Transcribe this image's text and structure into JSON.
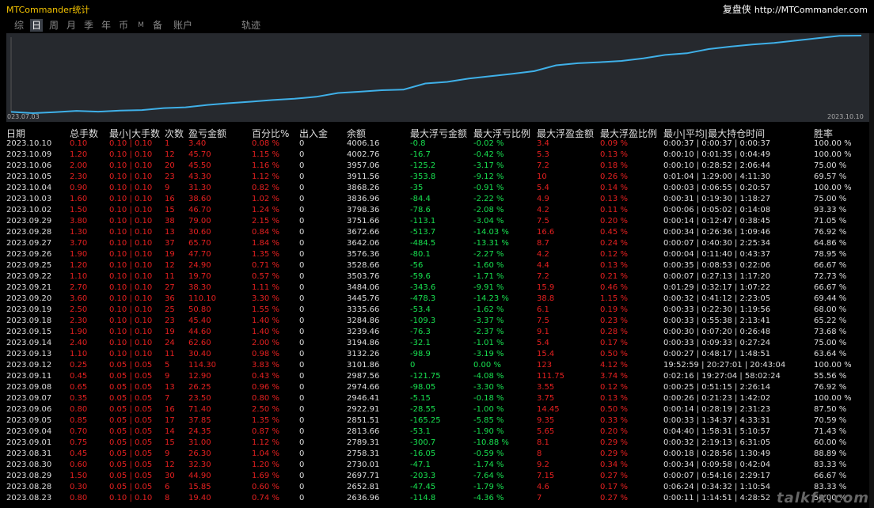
{
  "window": {
    "title": "MTCommander统计",
    "brand_cn": "复盘侠",
    "brand_url": "http://MTCommander.com"
  },
  "tabs": [
    {
      "label": "综",
      "active": false,
      "small": false
    },
    {
      "label": "日",
      "active": true,
      "small": false
    },
    {
      "label": "周",
      "active": false,
      "small": false
    },
    {
      "label": "月",
      "active": false,
      "small": false
    },
    {
      "label": "季",
      "active": false,
      "small": false
    },
    {
      "label": "年",
      "active": false,
      "small": false
    },
    {
      "label": "币",
      "active": false,
      "small": false
    },
    {
      "label": "M",
      "active": false,
      "small": true
    },
    {
      "label": "备",
      "active": false,
      "small": false
    },
    {
      "label": "账户",
      "active": false,
      "small": false
    },
    {
      "label": "轨迹",
      "active": false,
      "small": false
    }
  ],
  "chart_data": {
    "type": "line",
    "x_start_label": "023.07.03",
    "x_end_label": "2023.10.10",
    "line_color": "#3fb0e8",
    "values": [
      2565.51,
      2542.0,
      2560.0,
      2586.0,
      2571.0,
      2590.0,
      2600.0,
      2636.96,
      2652.81,
      2697.71,
      2730.01,
      2758.31,
      2789.31,
      2813.66,
      2851.51,
      2922.91,
      2946.41,
      2974.66,
      2987.56,
      3101.86,
      3132.26,
      3194.86,
      3239.46,
      3284.86,
      3335.66,
      3445.76,
      3484.06,
      3503.76,
      3528.66,
      3576.36,
      3642.06,
      3672.66,
      3751.66,
      3798.36,
      3836.96,
      3868.26,
      3911.56,
      3957.06,
      4002.76,
      4006.16
    ]
  },
  "table": {
    "headers": [
      "日期",
      "总手数",
      "最小|大手数",
      "次数",
      "盈亏金额",
      "百分比%",
      "出入金",
      "余额",
      "最大浮亏金额",
      "最大浮亏比例",
      "最大浮盈金额",
      "最大浮盈比例",
      "最小|平均|最大持仓时间",
      "胜率"
    ],
    "rows": [
      [
        "2023.10.10",
        "0.10",
        "0.10 | 0.10",
        "1",
        "3.40",
        "0.08 %",
        "0",
        "4006.16",
        "-0.8",
        "-0.02 %",
        "3.4",
        "0.09 %",
        "0:00:37 | 0:00:37 | 0:00:37",
        "100.00 %"
      ],
      [
        "2023.10.09",
        "1.20",
        "0.10 | 0.10",
        "12",
        "45.70",
        "1.15 %",
        "0",
        "4002.76",
        "-16.7",
        "-0.42 %",
        "5.3",
        "0.13 %",
        "0:00:10 | 0:01:35 | 0:04:49",
        "100.00 %"
      ],
      [
        "2023.10.06",
        "2.00",
        "0.10 | 0.10",
        "20",
        "45.50",
        "1.16 %",
        "0",
        "3957.06",
        "-125.2",
        "-3.17 %",
        "7.2",
        "0.18 %",
        "0:00:10 | 0:28:52 | 2:06:44",
        "75.00 %"
      ],
      [
        "2023.10.05",
        "2.30",
        "0.10 | 0.10",
        "23",
        "43.30",
        "1.12 %",
        "0",
        "3911.56",
        "-353.8",
        "-9.12 %",
        "10",
        "0.26 %",
        "0:01:04 | 1:29:00 | 4:11:30",
        "69.57 %"
      ],
      [
        "2023.10.04",
        "0.90",
        "0.10 | 0.10",
        "9",
        "31.30",
        "0.82 %",
        "0",
        "3868.26",
        "-35",
        "-0.91 %",
        "5.4",
        "0.14 %",
        "0:00:03 | 0:06:55 | 0:20:57",
        "100.00 %"
      ],
      [
        "2023.10.03",
        "1.60",
        "0.10 | 0.10",
        "16",
        "38.60",
        "1.02 %",
        "0",
        "3836.96",
        "-84.4",
        "-2.22 %",
        "4.9",
        "0.13 %",
        "0:00:31 | 0:19:30 | 1:18:27",
        "75.00 %"
      ],
      [
        "2023.10.02",
        "1.50",
        "0.10 | 0.10",
        "15",
        "46.70",
        "1.24 %",
        "0",
        "3798.36",
        "-78.6",
        "-2.08 %",
        "4.2",
        "0.11 %",
        "0:00:06 | 0:05:02 | 0:14:08",
        "93.33 %"
      ],
      [
        "2023.09.29",
        "3.80",
        "0.10 | 0.10",
        "38",
        "79.00",
        "2.15 %",
        "0",
        "3751.66",
        "-113.1",
        "-3.04 %",
        "7.5",
        "0.20 %",
        "0:00:14 | 0:12:47 | 0:38:45",
        "71.05 %"
      ],
      [
        "2023.09.28",
        "1.30",
        "0.10 | 0.10",
        "13",
        "30.60",
        "0.84 %",
        "0",
        "3672.66",
        "-513.7",
        "-14.03 %",
        "16.6",
        "0.45 %",
        "0:00:34 | 0:26:36 | 1:09:46",
        "76.92 %"
      ],
      [
        "2023.09.27",
        "3.70",
        "0.10 | 0.10",
        "37",
        "65.70",
        "1.84 %",
        "0",
        "3642.06",
        "-484.5",
        "-13.31 %",
        "8.7",
        "0.24 %",
        "0:00:07 | 0:40:30 | 2:25:34",
        "64.86 %"
      ],
      [
        "2023.09.26",
        "1.90",
        "0.10 | 0.10",
        "19",
        "47.70",
        "1.35 %",
        "0",
        "3576.36",
        "-80.1",
        "-2.27 %",
        "4.2",
        "0.12 %",
        "0:00:04 | 0:11:40 | 0:43:37",
        "78.95 %"
      ],
      [
        "2023.09.25",
        "1.20",
        "0.10 | 0.10",
        "12",
        "24.90",
        "0.71 %",
        "0",
        "3528.66",
        "-56",
        "-1.60 %",
        "4.4",
        "0.13 %",
        "0:00:35 | 0:08:53 | 0:22:06",
        "66.67 %"
      ],
      [
        "2023.09.22",
        "1.10",
        "0.10 | 0.10",
        "11",
        "19.70",
        "0.57 %",
        "0",
        "3503.76",
        "-59.6",
        "-1.71 %",
        "7.2",
        "0.21 %",
        "0:00:07 | 0:27:13 | 1:17:20",
        "72.73 %"
      ],
      [
        "2023.09.21",
        "2.70",
        "0.10 | 0.10",
        "27",
        "38.30",
        "1.11 %",
        "0",
        "3484.06",
        "-343.6",
        "-9.91 %",
        "15.9",
        "0.46 %",
        "0:01:29 | 0:32:17 | 1:07:22",
        "66.67 %"
      ],
      [
        "2023.09.20",
        "3.60",
        "0.10 | 0.10",
        "36",
        "110.10",
        "3.30 %",
        "0",
        "3445.76",
        "-478.3",
        "-14.23 %",
        "38.8",
        "1.15 %",
        "0:00:32 | 0:41:12 | 2:23:05",
        "69.44 %"
      ],
      [
        "2023.09.19",
        "2.50",
        "0.10 | 0.10",
        "25",
        "50.80",
        "1.55 %",
        "0",
        "3335.66",
        "-53.4",
        "-1.62 %",
        "6.1",
        "0.19 %",
        "0:00:33 | 0:22:30 | 1:19:56",
        "68.00 %"
      ],
      [
        "2023.09.18",
        "2.30",
        "0.10 | 0.10",
        "23",
        "45.40",
        "1.40 %",
        "0",
        "3284.86",
        "-109.3",
        "-3.37 %",
        "7.5",
        "0.23 %",
        "0:00:33 | 0:55:38 | 2:13:41",
        "65.22 %"
      ],
      [
        "2023.09.15",
        "1.90",
        "0.10 | 0.10",
        "19",
        "44.60",
        "1.40 %",
        "0",
        "3239.46",
        "-76.3",
        "-2.37 %",
        "9.1",
        "0.28 %",
        "0:00:30 | 0:07:20 | 0:26:48",
        "73.68 %"
      ],
      [
        "2023.09.14",
        "2.40",
        "0.10 | 0.10",
        "24",
        "62.60",
        "2.00 %",
        "0",
        "3194.86",
        "-32.1",
        "-1.01 %",
        "5.4",
        "0.17 %",
        "0:00:33 | 0:09:33 | 0:27:24",
        "75.00 %"
      ],
      [
        "2023.09.13",
        "1.10",
        "0.10 | 0.10",
        "11",
        "30.40",
        "0.98 %",
        "0",
        "3132.26",
        "-98.9",
        "-3.19 %",
        "15.4",
        "0.50 %",
        "0:00:27 | 0:48:17 | 1:48:51",
        "63.64 %"
      ],
      [
        "2023.09.12",
        "0.25",
        "0.05 | 0.05",
        "5",
        "114.30",
        "3.83 %",
        "0",
        "3101.86",
        "0",
        "0.00 %",
        "123",
        "4.12 %",
        "19:52:59 | 20:27:01 | 20:43:04",
        "100.00 %"
      ],
      [
        "2023.09.11",
        "0.45",
        "0.05 | 0.05",
        "9",
        "12.90",
        "0.43 %",
        "0",
        "2987.56",
        "-121.75",
        "-4.08 %",
        "111.75",
        "3.74 %",
        "0:02:16 | 19:27:04 | 58:02:24",
        "55.56 %"
      ],
      [
        "2023.09.08",
        "0.65",
        "0.05 | 0.05",
        "13",
        "26.25",
        "0.96 %",
        "0",
        "2974.66",
        "-98.05",
        "-3.30 %",
        "3.55",
        "0.12 %",
        "0:00:25 | 0:51:15 | 2:26:14",
        "76.92 %"
      ],
      [
        "2023.09.07",
        "0.35",
        "0.05 | 0.05",
        "7",
        "23.50",
        "0.80 %",
        "0",
        "2946.41",
        "-5.15",
        "-0.18 %",
        "3.75",
        "0.13 %",
        "0:00:26 | 0:21:23 | 1:42:02",
        "100.00 %"
      ],
      [
        "2023.09.06",
        "0.80",
        "0.05 | 0.05",
        "16",
        "71.40",
        "2.50 %",
        "0",
        "2922.91",
        "-28.55",
        "-1.00 %",
        "14.45",
        "0.50 %",
        "0:00:14 | 0:28:19 | 2:31:23",
        "87.50 %"
      ],
      [
        "2023.09.05",
        "0.85",
        "0.05 | 0.05",
        "17",
        "37.85",
        "1.35 %",
        "0",
        "2851.51",
        "-165.25",
        "-5.85 %",
        "9.35",
        "0.33 %",
        "0:00:33 | 1:34:37 | 4:33:31",
        "70.59 %"
      ],
      [
        "2023.09.04",
        "0.70",
        "0.05 | 0.05",
        "14",
        "24.35",
        "0.87 %",
        "0",
        "2813.66",
        "-53.1",
        "-1.90 %",
        "5.65",
        "0.20 %",
        "0:04:40 | 1:58:31 | 5:10:57",
        "71.43 %"
      ],
      [
        "2023.09.01",
        "0.75",
        "0.05 | 0.05",
        "15",
        "31.00",
        "1.12 %",
        "0",
        "2789.31",
        "-300.7",
        "-10.88 %",
        "8.1",
        "0.29 %",
        "0:00:32 | 2:19:13 | 6:31:05",
        "60.00 %"
      ],
      [
        "2023.08.31",
        "0.45",
        "0.05 | 0.05",
        "9",
        "26.30",
        "1.04 %",
        "0",
        "2758.31",
        "-16.05",
        "-0.59 %",
        "8",
        "0.29 %",
        "0:00:18 | 0:28:56 | 1:30:49",
        "88.89 %"
      ],
      [
        "2023.08.30",
        "0.60",
        "0.05 | 0.05",
        "12",
        "32.30",
        "1.20 %",
        "0",
        "2730.01",
        "-47.1",
        "-1.74 %",
        "9.2",
        "0.34 %",
        "0:00:34 | 0:09:58 | 0:42:04",
        "83.33 %"
      ],
      [
        "2023.08.29",
        "1.50",
        "0.05 | 0.05",
        "30",
        "44.90",
        "1.69 %",
        "0",
        "2697.71",
        "-203.3",
        "-7.64 %",
        "7.15",
        "0.27 %",
        "0:00:07 | 0:54:16 | 2:29:17",
        "66.67 %"
      ],
      [
        "2023.08.28",
        "0.30",
        "0.05 | 0.05",
        "6",
        "15.85",
        "0.60 %",
        "0",
        "2652.81",
        "-47.45",
        "-1.79 %",
        "4.6",
        "0.17 %",
        "0:06:24 | 0:34:32 | 1:10:54",
        "83.33 %"
      ],
      [
        "2023.08.23",
        "0.80",
        "0.10 | 0.10",
        "8",
        "19.40",
        "0.74 %",
        "0",
        "2636.96",
        "-114.8",
        "-4.36 %",
        "7",
        "0.27 %",
        "0:00:11 | 1:14:51 | 4:28:52",
        "50.00 %"
      ]
    ]
  },
  "watermark": "talkfx.com"
}
